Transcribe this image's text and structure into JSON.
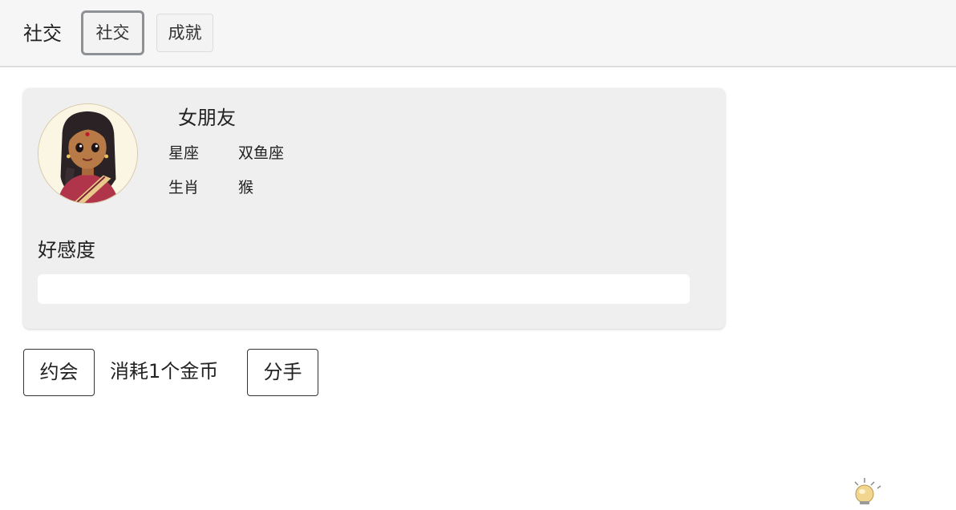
{
  "header": {
    "brand": "社交",
    "tabs": [
      {
        "label": "社交",
        "active": true
      },
      {
        "label": "成就",
        "active": false
      }
    ]
  },
  "character": {
    "name": "女朋友",
    "avatar_icon": "girl-avatar-icon",
    "attributes": [
      {
        "label": "星座",
        "value": "双鱼座"
      },
      {
        "label": "生肖",
        "value": "猴"
      }
    ]
  },
  "affection": {
    "label": "好感度",
    "value_percent": 0
  },
  "actions": {
    "date_label": "约会",
    "cost_text": "消耗1个金币",
    "breakup_label": "分手"
  },
  "colors": {
    "topbar_bg": "#f6f6f6",
    "card_bg": "#efefef",
    "active_tab_border": "#8e9297"
  }
}
